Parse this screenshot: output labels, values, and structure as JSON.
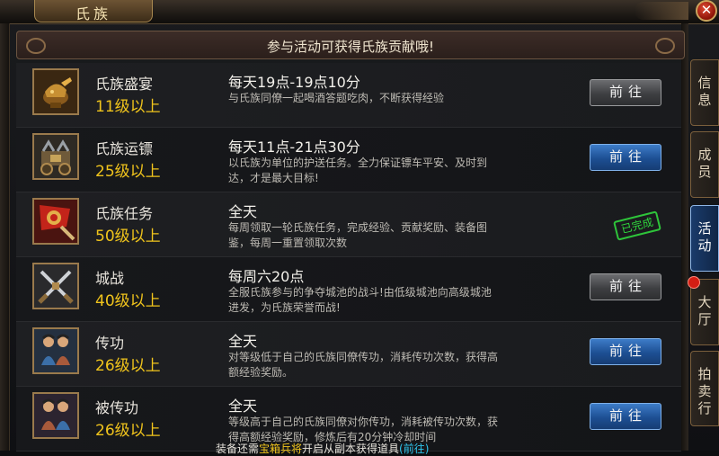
{
  "window": {
    "title": "氏族",
    "banner": "参与活动可获得氏族贡献哦!"
  },
  "rows": [
    {
      "name": "氏族盛宴",
      "level": "11级以上",
      "time": "每天19点-19点10分",
      "desc": "与氏族同僚一起喝酒答题吃肉，不断获得经验",
      "action": "前往",
      "button_style": "gray",
      "icon": "feast-cup-icon"
    },
    {
      "name": "氏族运镖",
      "level": "25级以上",
      "time": "每天11点-21点30分",
      "desc": "以氏族为单位的护送任务。全力保证镖车平安、及时到达，才是最大目标!",
      "action": "前往",
      "button_style": "blue",
      "icon": "escort-cart-icon"
    },
    {
      "name": "氏族任务",
      "level": "50级以上",
      "time": "全天",
      "desc": "每周领取一轮氏族任务，完成经验、贡献奖励、装备图鉴，每周一重置领取次数",
      "status": "已完成",
      "icon": "clan-flag-icon"
    },
    {
      "name": "城战",
      "level": "40级以上",
      "time": "每周六20点",
      "desc": "全服氏族参与的争夺城池的战斗!由低级城池向高级城池进发，为氏族荣誉而战!",
      "action": "前往",
      "button_style": "gray",
      "icon": "crossed-swords-icon"
    },
    {
      "name": "传功",
      "level": "26级以上",
      "time": "全天",
      "desc": "对等级低于自己的氏族同僚传功，消耗传功次数，获得高额经验奖励。",
      "action": "前往",
      "button_style": "blue",
      "icon": "meditating-pair-icon"
    },
    {
      "name": "被传功",
      "level": "26级以上",
      "time": "全天",
      "desc": "等级高于自己的氏族同僚对你传功，消耗被传功次数，获得高额经验奖励，修炼后有20分钟冷却时间",
      "action": "前往",
      "button_style": "blue",
      "icon": "meditating-pair-icon"
    }
  ],
  "tabs": [
    {
      "label": "信息",
      "active": false
    },
    {
      "label": "成员",
      "active": false
    },
    {
      "label": "活动",
      "active": true
    },
    {
      "label": "大厅",
      "active": false,
      "badge": true
    },
    {
      "label": "拍卖行",
      "active": false
    }
  ],
  "footer": {
    "prefix": "装备还需",
    "highlight1": "宝箱兵将",
    "middle": "开启从副本获得道具",
    "highlight2": "(前往)"
  },
  "colors": {
    "level_gold": "#f0c41c",
    "button_blue": "#1d4f93",
    "button_gray": "#3e3f42",
    "stamp_green": "#2ed63c",
    "tab_active": "#1a3b6b"
  }
}
